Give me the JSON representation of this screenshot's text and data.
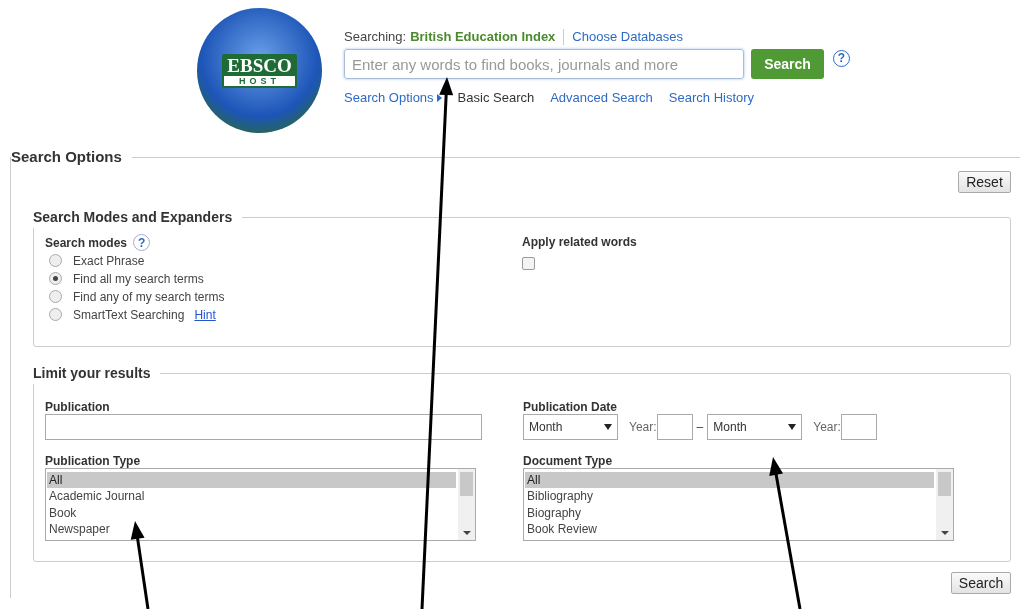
{
  "logo": {
    "top": "EBSCO",
    "bottom": "HOST"
  },
  "header": {
    "searching_label": "Searching:",
    "database": "British Education Index",
    "choose_databases": "Choose Databases",
    "search_field": {
      "placeholder": "Enter any words to find books, journals and more"
    },
    "search_button": "Search",
    "help": "?",
    "nav": [
      {
        "label": "Search Options",
        "kind": "menu",
        "selected": false
      },
      {
        "label": "Basic Search",
        "kind": "link",
        "selected": true
      },
      {
        "label": "Advanced Search",
        "kind": "link",
        "selected": false
      },
      {
        "label": "Search History",
        "kind": "link",
        "selected": false
      }
    ]
  },
  "search_options": {
    "title": "Search Options",
    "reset": "Reset",
    "modes_section": {
      "title": "Search Modes and Expanders",
      "modes_label": "Search modes",
      "help": "?",
      "modes": [
        {
          "label": "Exact Phrase",
          "selected": false
        },
        {
          "label": "Find all my search terms",
          "selected": true
        },
        {
          "label": "Find any of my search terms",
          "selected": false
        },
        {
          "label": "SmartText Searching",
          "selected": false,
          "hint": "Hint"
        }
      ],
      "related": {
        "label": "Apply related words",
        "checked": false
      }
    },
    "limits": {
      "title": "Limit your results",
      "publication": {
        "label": "Publication"
      },
      "publication_date": {
        "label": "Publication Date",
        "from_month": "Month",
        "from_year_label": "Year:",
        "separator": "–",
        "to_month": "Month",
        "to_year_label": "Year:"
      },
      "publication_type": {
        "label": "Publication Type",
        "options": [
          {
            "label": "All",
            "selected": true
          },
          {
            "label": "Academic Journal",
            "selected": false
          },
          {
            "label": "Book",
            "selected": false
          },
          {
            "label": "Newspaper",
            "selected": false
          }
        ]
      },
      "document_type": {
        "label": "Document Type",
        "options": [
          {
            "label": "All",
            "selected": true
          },
          {
            "label": "Bibliography",
            "selected": false
          },
          {
            "label": "Biography",
            "selected": false
          },
          {
            "label": "Book Review",
            "selected": false
          }
        ]
      }
    },
    "search_button": "Search"
  }
}
